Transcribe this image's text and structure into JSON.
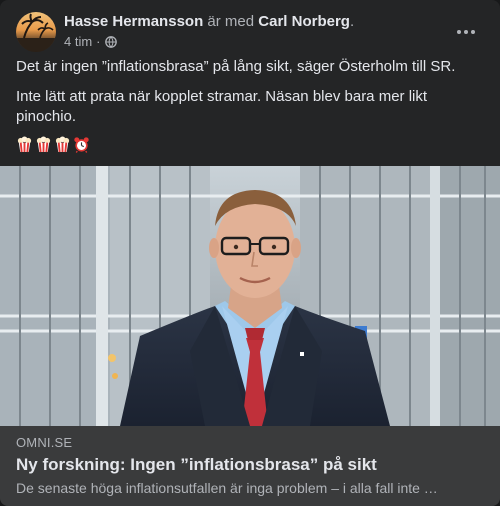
{
  "post": {
    "author": "Hasse Hermansson",
    "with_text": "är med",
    "tagged": "Carl Norberg",
    "tagged_suffix": ".",
    "time": "4 tim",
    "privacy_icon": "globe-icon",
    "more_icon": "more-horizontal-icon",
    "paragraphs": [
      "Det är ingen ”inflationsbrasa” på lång sikt, säger Österholm till SR.",
      "Inte lätt att prata när kopplet stramar. Näsan blev bara mer likt pinochio."
    ],
    "emojis": [
      "popcorn-emoji",
      "popcorn-emoji",
      "popcorn-emoji",
      "alarm-clock-emoji"
    ]
  },
  "link": {
    "domain": "OMNI.SE",
    "title": "Ny forskning: Ingen ”inflationsbrasa” på sikt",
    "description": "De senaste höga inflationsutfallen är inga problem – i alla fall inte …"
  },
  "colors": {
    "card_bg": "#242526",
    "link_bg": "#3a3b3c",
    "primary_text": "#e4e6eb",
    "secondary_text": "#b0b3b8"
  }
}
